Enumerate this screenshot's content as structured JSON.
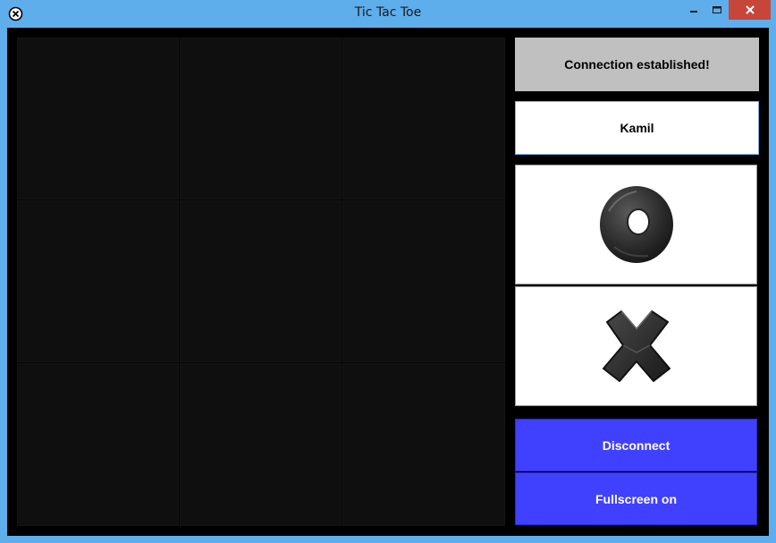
{
  "window": {
    "title": "Tic Tac Toe"
  },
  "board": {
    "cells": [
      "",
      "",
      "",
      "",
      "",
      "",
      "",
      "",
      ""
    ]
  },
  "status": {
    "text": "Connection established!"
  },
  "player": {
    "name": "Kamil"
  },
  "pieces": {
    "o_icon": "o-piece-icon",
    "x_icon": "x-piece-icon"
  },
  "buttons": {
    "disconnect": "Disconnect",
    "fullscreen": "Fullscreen on"
  },
  "colors": {
    "button_bg": "#4040ff",
    "status_bg": "#c0c0c0",
    "titlebar_bg": "#5eaeec"
  }
}
